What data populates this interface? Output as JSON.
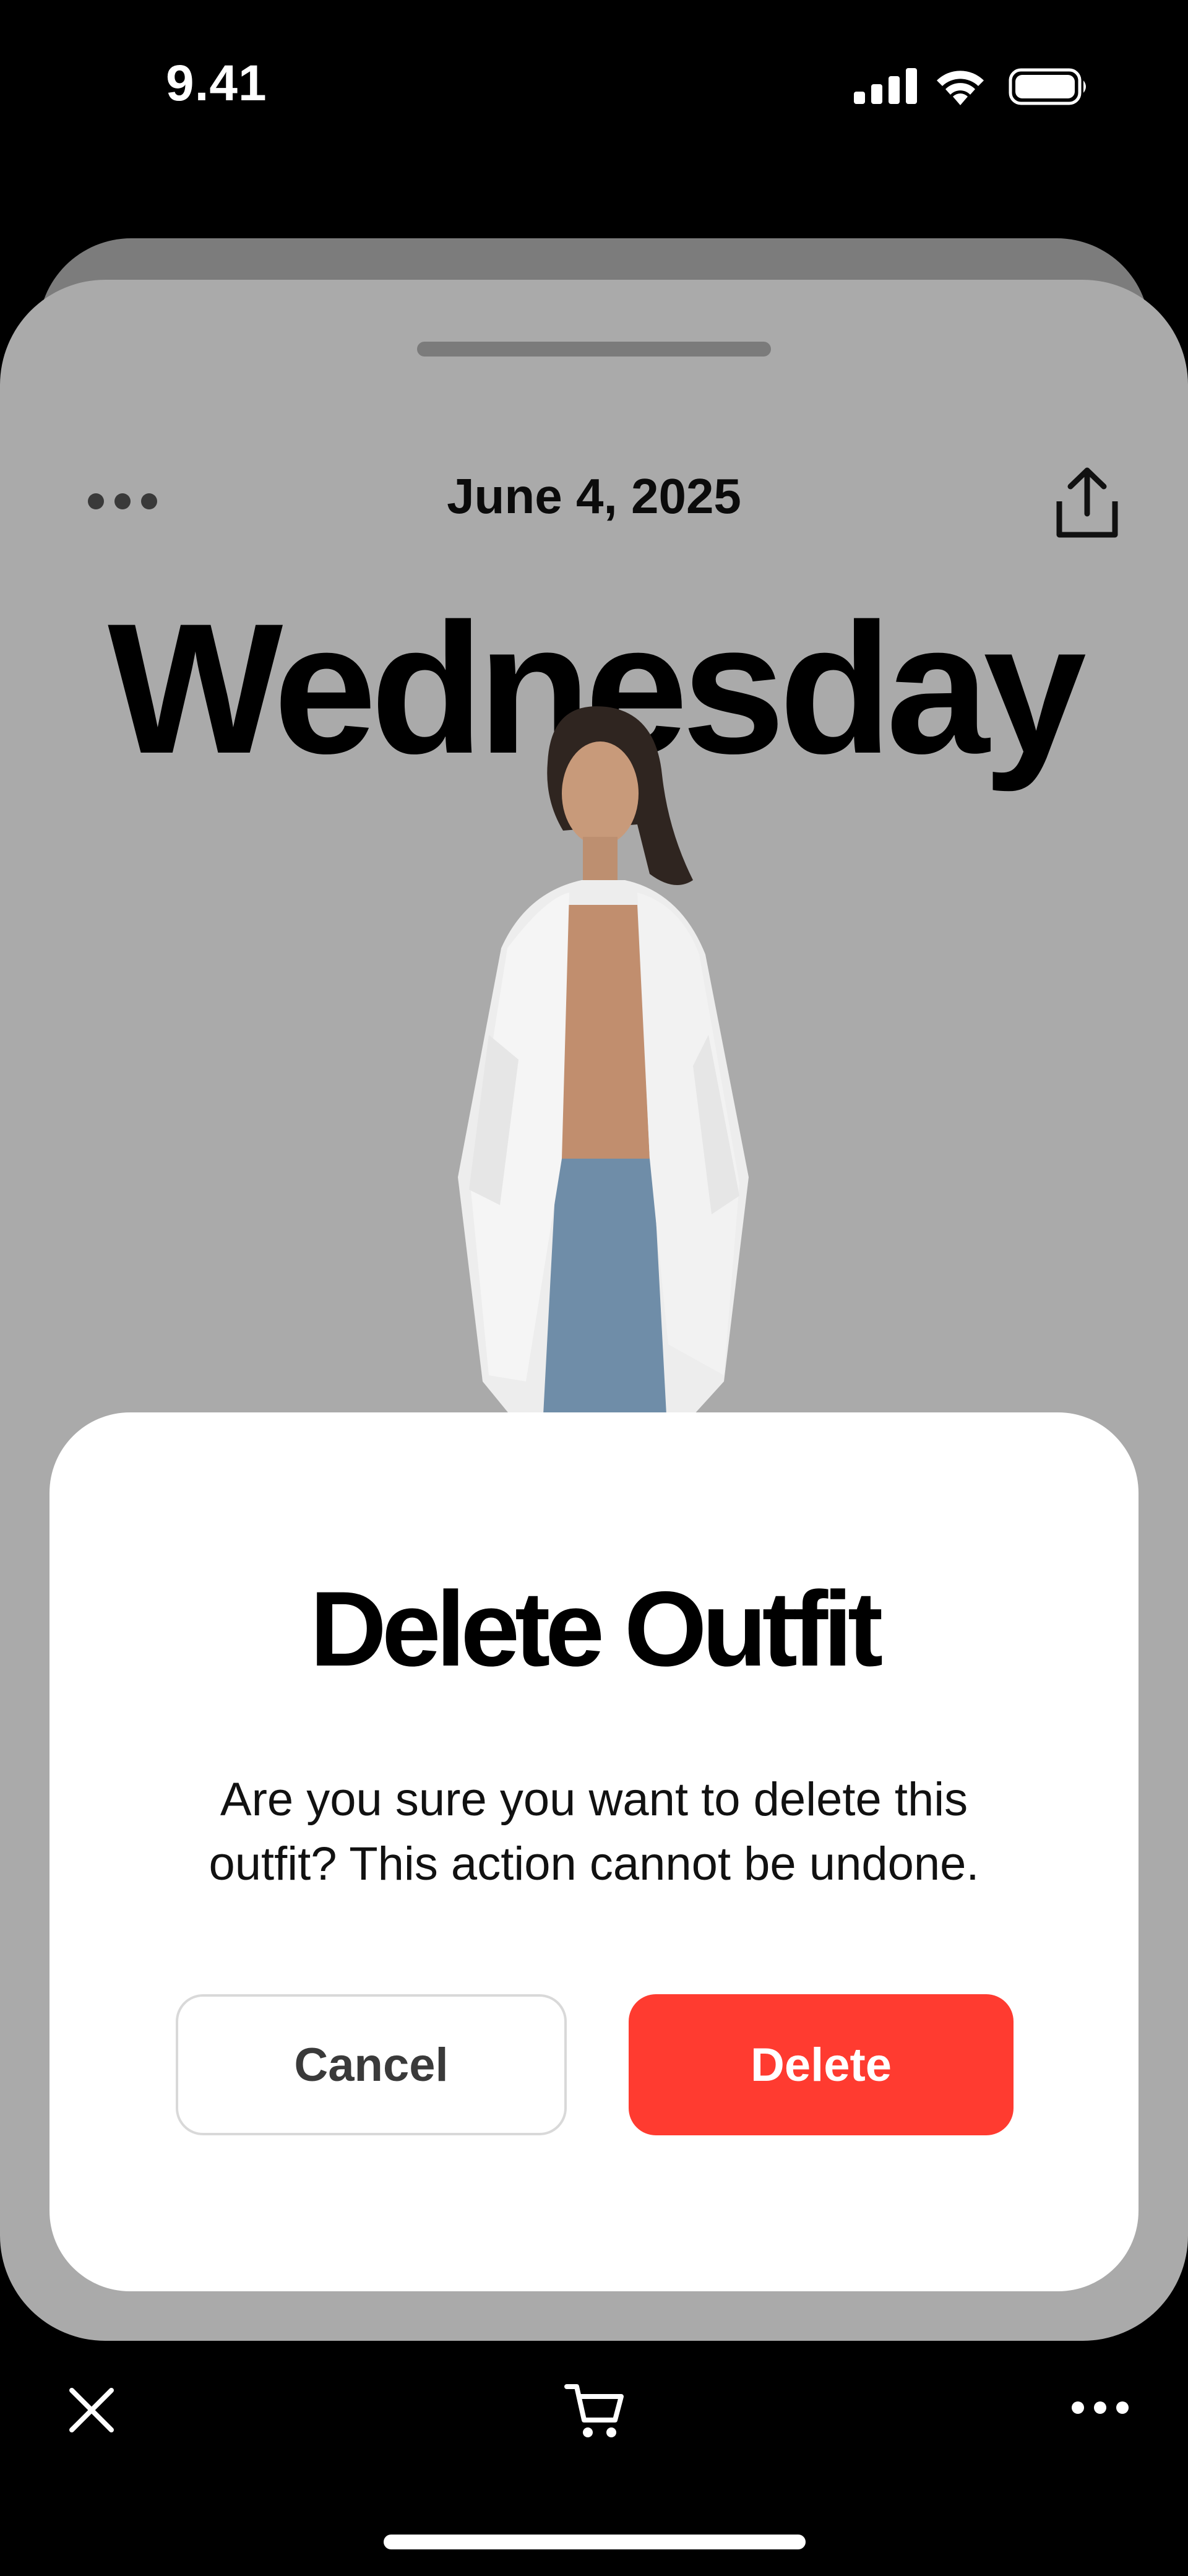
{
  "status_bar": {
    "time": "9.41",
    "signal_icon": "cellular-signal-icon",
    "wifi_icon": "wifi-icon",
    "battery_icon": "battery-icon"
  },
  "card": {
    "more_icon": "more-horizontal-icon",
    "date": "June 4, 2025",
    "share_icon": "share-icon",
    "day": "Wednesday",
    "outfit_image": "outfit-model-image"
  },
  "dialog": {
    "title": "Delete Outfit",
    "message": "Are you sure you want to delete this outfit? This action cannot be undone.",
    "cancel_label": "Cancel",
    "delete_label": "Delete"
  },
  "toolbar": {
    "close_icon": "close-icon",
    "cart_icon": "cart-icon",
    "more_icon": "more-horizontal-icon"
  },
  "colors": {
    "backdrop": "#000000",
    "card_dimmed": "#aaaaaa",
    "dialog_bg": "#ffffff",
    "destructive": "#ff3b30"
  }
}
